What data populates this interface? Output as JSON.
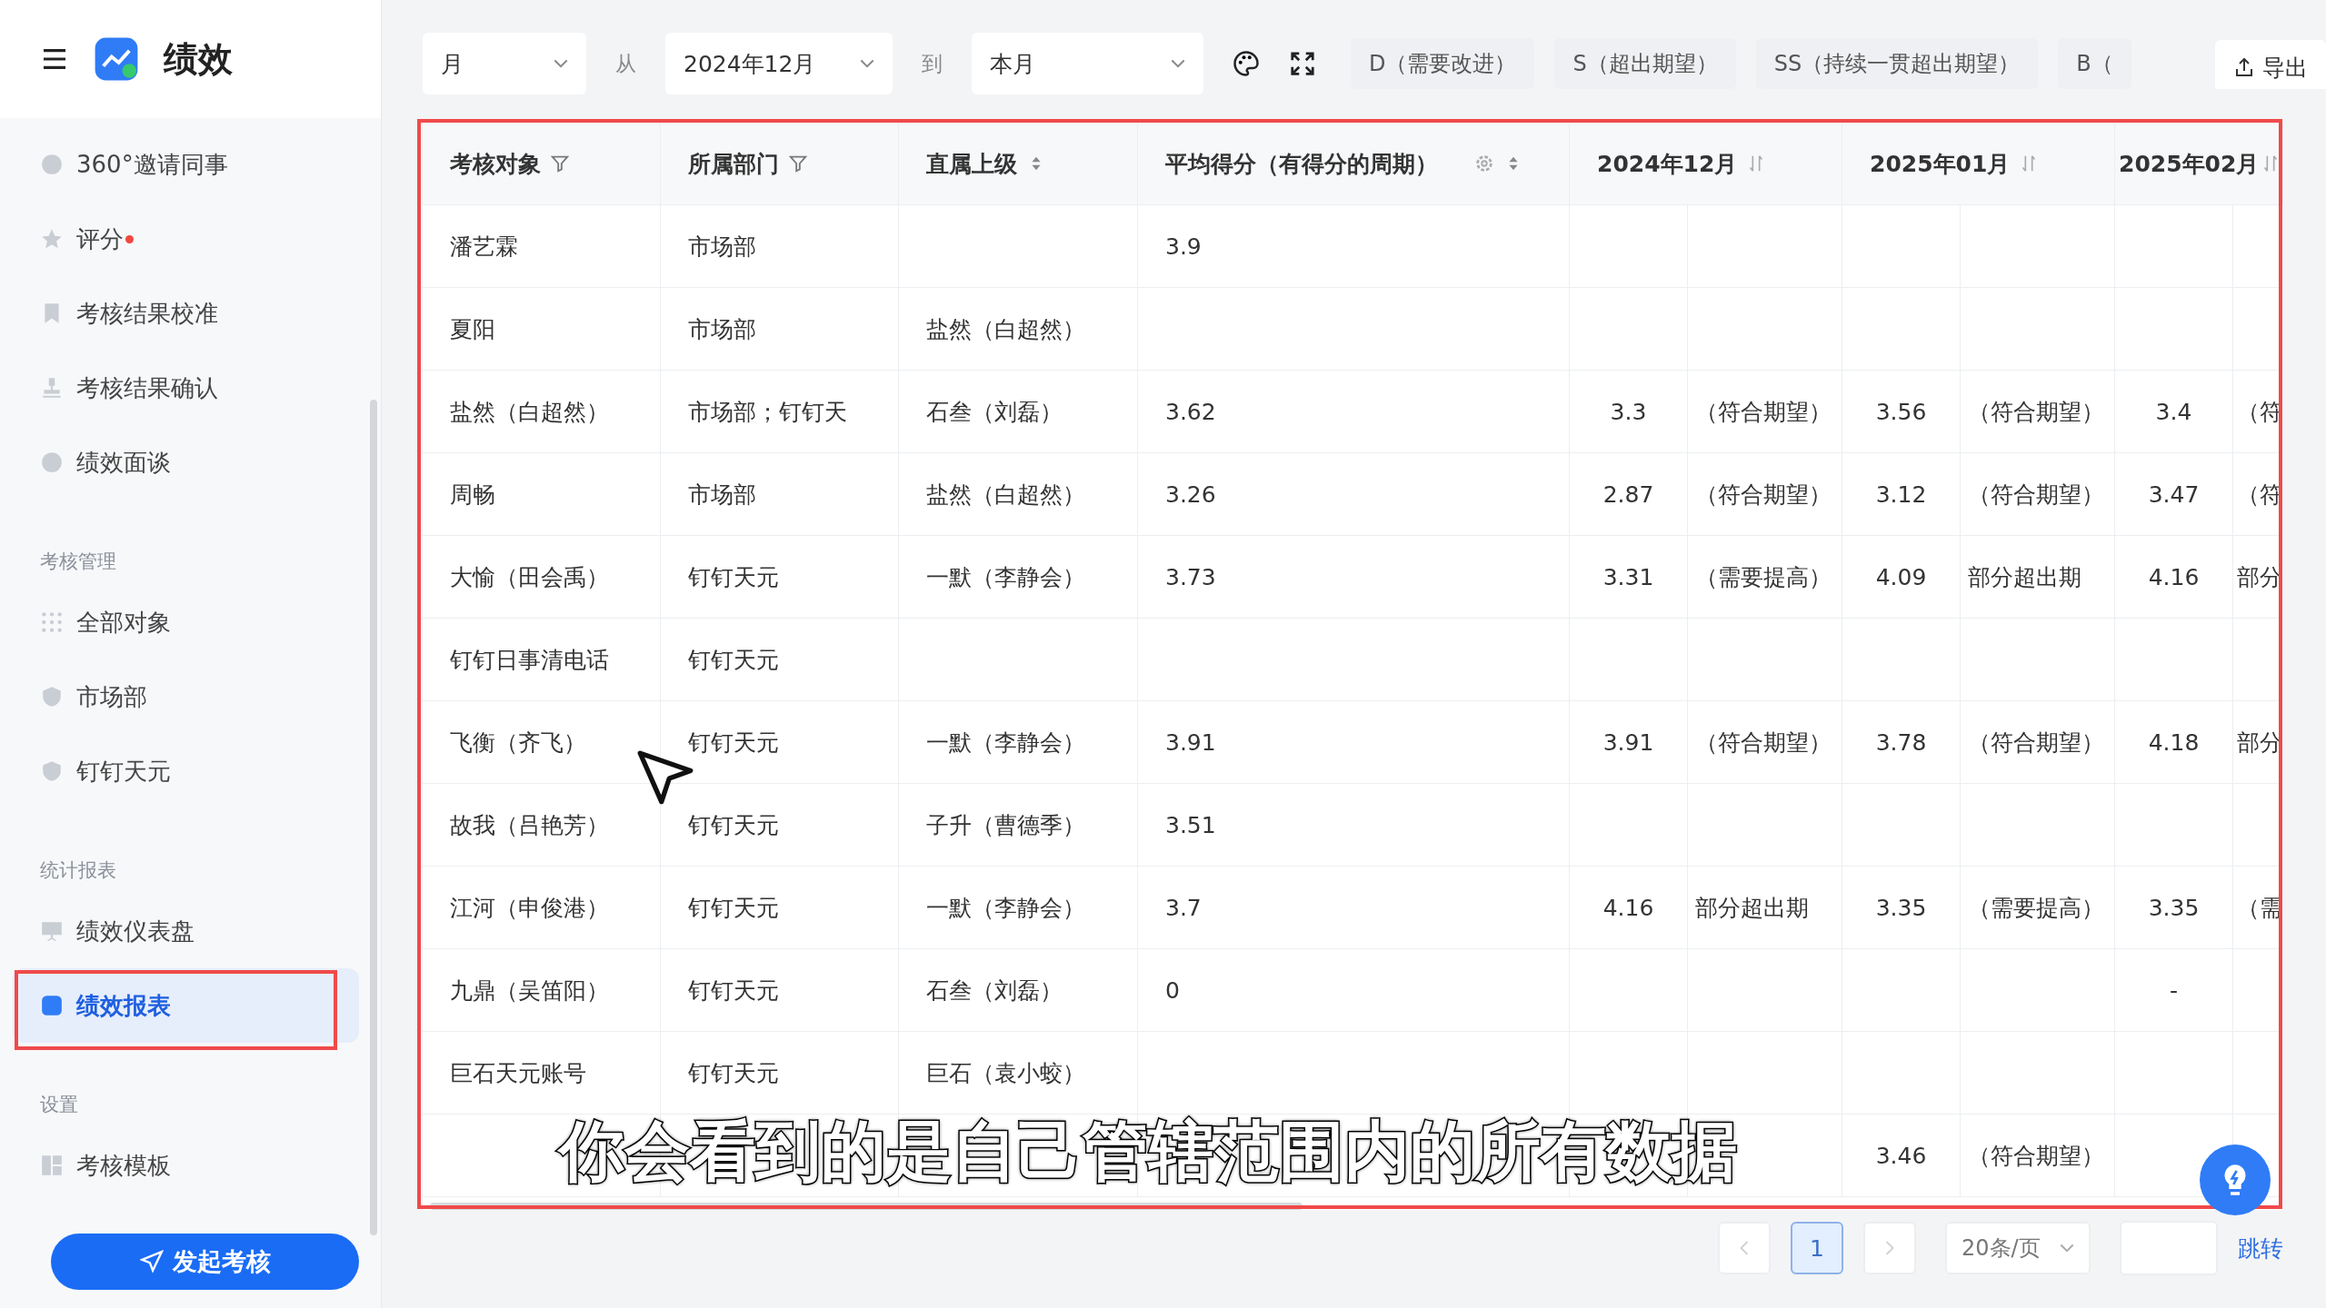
{
  "app": {
    "title": "绩效"
  },
  "sidebar": {
    "groups": [
      {
        "items": [
          {
            "label": "360°邀请同事",
            "selected": false,
            "dot": false
          },
          {
            "label": "评分",
            "selected": false,
            "dot": true
          },
          {
            "label": "考核结果校准",
            "selected": false,
            "dot": false
          },
          {
            "label": "考核结果确认",
            "selected": false,
            "dot": false
          },
          {
            "label": "绩效面谈",
            "selected": false,
            "dot": false
          }
        ]
      },
      {
        "heading": "考核管理",
        "items": [
          {
            "label": "全部对象",
            "selected": false,
            "dot": false
          },
          {
            "label": "市场部",
            "selected": false,
            "dot": false
          },
          {
            "label": "钉钉天元",
            "selected": false,
            "dot": false
          }
        ]
      },
      {
        "heading": "统计报表",
        "items": [
          {
            "label": "绩效仪表盘",
            "selected": false,
            "dot": false
          },
          {
            "label": "绩效报表",
            "selected": true,
            "dot": false
          }
        ]
      },
      {
        "heading": "设置",
        "items": [
          {
            "label": "考核模板",
            "selected": false,
            "dot": false
          }
        ]
      }
    ],
    "start_button": "发起考核"
  },
  "toolbar": {
    "period_select": "月",
    "from_label": "从",
    "from_select": "2024年12月",
    "to_label": "到",
    "to_select": "本月",
    "legend": [
      "D（需要改进）",
      "S（超出期望）",
      "SS（持续一贯超出期望）",
      "B（"
    ],
    "export_button": "导出"
  },
  "table": {
    "columns": [
      {
        "label": "考核对象",
        "filter": true,
        "sort": false,
        "settings": false
      },
      {
        "label": "所属部门",
        "filter": true,
        "sort": false,
        "settings": false
      },
      {
        "label": "直属上级",
        "filter": false,
        "sort": true,
        "settings": false
      },
      {
        "label": "平均得分（有得分的周期）",
        "filter": false,
        "sort": true,
        "settings": true
      }
    ],
    "period_columns": [
      {
        "label": "2024年12月",
        "sort": true
      },
      {
        "label": "2025年01月",
        "sort": true
      },
      {
        "label": "2025年02月",
        "sort": true
      }
    ],
    "rows": [
      {
        "name": "潘艺霖",
        "department": "市场部",
        "average": "3.9"
      },
      {
        "name": "夏阳",
        "department": "市场部",
        "manager": "盐然（白超然）"
      },
      {
        "name": "盐然（白超然）",
        "department": "市场部；钉钉天",
        "manager": "石叁（刘磊）",
        "average": "3.62",
        "p1_score": "3.3",
        "p1_rating": "（符合期望）",
        "p2_score": "3.56",
        "p2_rating": "（符合期望）",
        "p3_score": "3.4",
        "p3_rating": "（符"
      },
      {
        "name": "周畅",
        "department": "市场部",
        "manager": "盐然（白超然）",
        "average": "3.26",
        "p1_score": "2.87",
        "p1_rating": "（符合期望）",
        "p2_score": "3.12",
        "p2_rating": "（符合期望）",
        "p3_score": "3.47",
        "p3_rating": "（符"
      },
      {
        "name": "大愉（田会禹）",
        "department": "钉钉天元",
        "manager": "一默（李静会）",
        "average": "3.73",
        "p1_score": "3.31",
        "p1_rating": "（需要提高）",
        "p2_score": "4.09",
        "p2_rating": "部分超出期",
        "p3_score": "4.16",
        "p3_rating": "部分"
      },
      {
        "name": "钉钉日事清电话",
        "department": "钉钉天元"
      },
      {
        "name": "飞衡（齐飞）",
        "department": "钉钉天元",
        "manager": "一默（李静会）",
        "average": "3.91",
        "p1_score": "3.91",
        "p1_rating": "（符合期望）",
        "p2_score": "3.78",
        "p2_rating": "（符合期望）",
        "p3_score": "4.18",
        "p3_rating": "部分"
      },
      {
        "name": "故我（吕艳芳）",
        "department": "钉钉天元",
        "manager": "子升（曹德季）",
        "average": "3.51"
      },
      {
        "name": "江河（申俊港）",
        "department": "钉钉天元",
        "manager": "一默（李静会）",
        "average": "3.7",
        "p1_score": "4.16",
        "p1_rating": "部分超出期",
        "p2_score": "3.35",
        "p2_rating": "（需要提高）",
        "p3_score": "3.35",
        "p3_rating": "（需"
      },
      {
        "name": "九鼎（吴笛阳）",
        "department": "钉钉天元",
        "manager": "石叁（刘磊）",
        "average": "0",
        "p3_score": "-"
      },
      {
        "name": "巨石天元账号",
        "department": "钉钉天元",
        "manager": "巨石（袁小蛟）"
      },
      {
        "p2_score": "3.46",
        "p2_rating": "（符合期望）"
      }
    ]
  },
  "pagination": {
    "pages": [
      {
        "label": "1",
        "selected": true
      }
    ],
    "page_size": "20条/页",
    "jump_label": "跳转"
  },
  "subtitle": "你会看到的是自己管辖范围内的所有数据"
}
